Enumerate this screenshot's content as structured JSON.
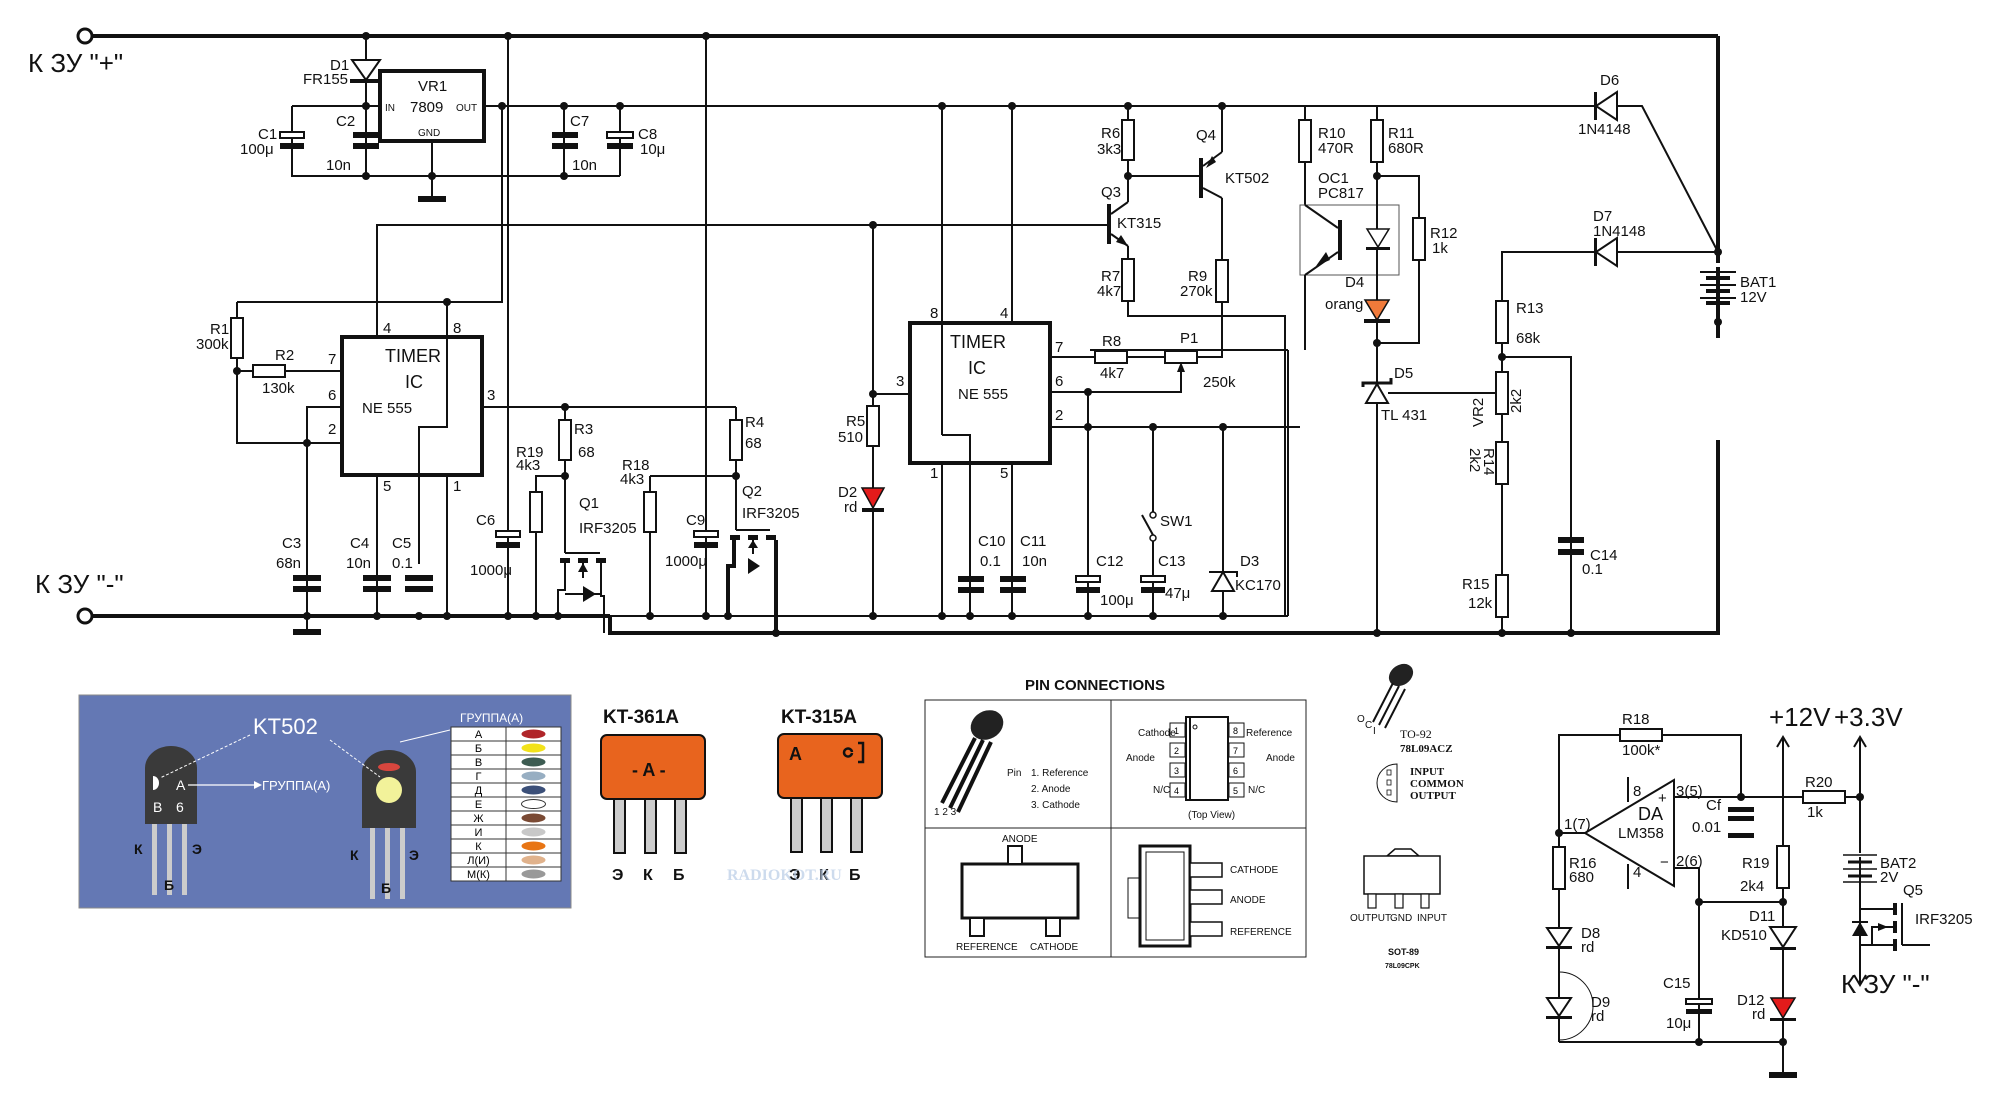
{
  "main": {
    "terminals": {
      "plus": "К ЗУ \"+\"",
      "minus": "К ЗУ \"-\"",
      "minus2": "К ЗУ \"-\""
    },
    "d1": {
      "ref": "D1",
      "val": "FR155"
    },
    "vr1": {
      "ref": "VR1",
      "part": "7809",
      "in": "IN",
      "out": "OUT",
      "gnd": "GND"
    },
    "c1": {
      "ref": "C1",
      "val": "100μ"
    },
    "c2": {
      "ref": "C2",
      "val": "10n"
    },
    "c7": {
      "ref": "C7",
      "val": "10n"
    },
    "c8": {
      "ref": "C8",
      "val": "10μ"
    },
    "timer1": {
      "l1": "TIMER",
      "l2": "IC",
      "part": "NE 555",
      "p4": "4",
      "p8": "8",
      "p7": "7",
      "p6": "6",
      "p2": "2",
      "p3": "3",
      "p5": "5",
      "p1": "1"
    },
    "timer2": {
      "l1": "TIMER",
      "l2": "IC",
      "part": "NE 555",
      "p4": "4",
      "p8": "8",
      "p7": "7",
      "p6": "6",
      "p2": "2",
      "p3": "3",
      "p5": "5",
      "p1": "1"
    },
    "r1": {
      "ref": "R1",
      "val": "300k"
    },
    "r2": {
      "ref": "R2",
      "val": "130k"
    },
    "r3": {
      "ref": "R3",
      "val": "68"
    },
    "r4": {
      "ref": "R4",
      "val": "68"
    },
    "r5": {
      "ref": "R5",
      "val": "510"
    },
    "r6": {
      "ref": "R6",
      "val": "3k3"
    },
    "r7": {
      "ref": "R7",
      "val": "4k7"
    },
    "r8": {
      "ref": "R8",
      "val": "4k7"
    },
    "r9": {
      "ref": "R9",
      "val": "270k"
    },
    "r10": {
      "ref": "R10",
      "val": "470R"
    },
    "r11": {
      "ref": "R11",
      "val": "680R"
    },
    "r12": {
      "ref": "R12",
      "val": "1k"
    },
    "r13": {
      "ref": "R13",
      "val": "68k"
    },
    "r14": {
      "ref": "R14",
      "val": "2k2"
    },
    "r15": {
      "ref": "R15",
      "val": "12k"
    },
    "r18": {
      "ref": "R18",
      "val": "4k3"
    },
    "r19": {
      "ref": "R19",
      "val": "4k3"
    },
    "p1": {
      "ref": "P1",
      "val": "250k"
    },
    "vr2": {
      "ref": "VR2",
      "val": "2k2"
    },
    "c3": {
      "ref": "C3",
      "val": "68n"
    },
    "c4": {
      "ref": "C4",
      "val": "10n"
    },
    "c5": {
      "ref": "C5",
      "val": "0.1"
    },
    "c6": {
      "ref": "C6",
      "val": "1000μ"
    },
    "c9": {
      "ref": "C9",
      "val": "1000μ"
    },
    "c10": {
      "ref": "C10",
      "val": "0.1"
    },
    "c11": {
      "ref": "C11",
      "val": "10n"
    },
    "c12": {
      "ref": "C12",
      "val": "100μ"
    },
    "c13": {
      "ref": "C13",
      "val": "47μ"
    },
    "c14": {
      "ref": "C14",
      "val": "0.1"
    },
    "q1": {
      "ref": "Q1",
      "val": "IRF3205"
    },
    "q2": {
      "ref": "Q2",
      "val": "IRF3205"
    },
    "q3": {
      "ref": "Q3",
      "val": "KT315"
    },
    "q4": {
      "ref": "Q4",
      "val": "KT502"
    },
    "oc1": {
      "ref": "OC1",
      "val": "PC817"
    },
    "d2": {
      "ref": "D2",
      "val": "rd"
    },
    "d3": {
      "ref": "D3",
      "val": "KC170"
    },
    "d4": {
      "ref": "D4",
      "val": "orang"
    },
    "d5": {
      "ref": "D5",
      "val": "TL 431"
    },
    "d6": {
      "ref": "D6",
      "val": "1N4148"
    },
    "d7": {
      "ref": "D7",
      "val": "1N4148"
    },
    "sw1": {
      "ref": "SW1"
    },
    "bat1": {
      "ref": "BAT1",
      "val": "12V"
    }
  },
  "kt502_panel": {
    "title": "KT502",
    "marking_a": "A",
    "marking_b": "B",
    "marking_6": "6",
    "group_label": "ГРУППА(А)",
    "group_label2": "ГРУППА(А)",
    "pins": {
      "k": "К",
      "b": "Б",
      "e": "Э"
    },
    "groups": [
      {
        "letter": "А",
        "color": "#b0262a"
      },
      {
        "letter": "Б",
        "color": "#f2e21a"
      },
      {
        "letter": "В",
        "color": "#3d5c52"
      },
      {
        "letter": "Г",
        "color": "#97aec2"
      },
      {
        "letter": "Д",
        "color": "#3b4f78"
      },
      {
        "letter": "Е",
        "color": "#ffffff"
      },
      {
        "letter": "Ж",
        "color": "#7a4a34"
      },
      {
        "letter": "И",
        "color": "#c8c8c8"
      },
      {
        "letter": "К",
        "color": "#e87514"
      },
      {
        "letter": "Л(И)",
        "color": "#e0b28c"
      },
      {
        "letter": "М(К)",
        "color": "#999999"
      }
    ],
    "bg_color": "#6478b4"
  },
  "kt361": {
    "title": "KT-361A",
    "mark": "- A -",
    "pins": [
      "Э",
      "К",
      "Б"
    ],
    "color": "#e8641e"
  },
  "kt315": {
    "title": "KT-315A",
    "mark": "A",
    "pins": [
      "Э",
      "К",
      "Б"
    ],
    "color": "#e8641e"
  },
  "watermark": "RADIOKOT.RU",
  "pin_connections": {
    "title": "PIN CONNECTIONS",
    "to92_pin_label": "Pin",
    "to92_pins": [
      "1.  Reference",
      "2.  Anode",
      "3.  Cathode"
    ],
    "to92_numbers": "1 2 3",
    "so8_left": [
      "Cathode",
      "Anode",
      "N/C"
    ],
    "so8_right": [
      "Reference",
      "Anode",
      "N/C"
    ],
    "so8_pins_left": [
      "1",
      "2",
      "3",
      "4"
    ],
    "so8_pins_right": [
      "8",
      "7",
      "6",
      "5"
    ],
    "so8_caption": "(Top View)",
    "sot23": {
      "top": "ANODE",
      "left": "REFERENCE",
      "right": "CATHODE"
    },
    "sot89": [
      "CATHODE",
      "ANODE",
      "REFERENCE"
    ]
  },
  "regulator_pkg": {
    "to92": "TO-92",
    "to92_part": "78L09ACZ",
    "to92_pins": [
      "INPUT",
      "COMMON",
      "OUTPUT"
    ],
    "to92_leg_labels": [
      "O",
      "C",
      "I"
    ],
    "sot89_pins": [
      "OUTPUT",
      "GND",
      "INPUT"
    ],
    "sot89": "SOT-89",
    "sot89_part": "78L09CPK"
  },
  "aux": {
    "r18": {
      "ref": "R18",
      "val": "100k*"
    },
    "da": {
      "ref": "DA",
      "part": "LM358",
      "p8": "8",
      "p4": "4",
      "p_out": "1(7)",
      "p_plus": "3(5)",
      "p_minus": "2(6)"
    },
    "cf": {
      "ref": "Cf",
      "val": "0.01"
    },
    "r16": {
      "ref": "R16",
      "val": "680"
    },
    "r19": {
      "ref": "R19",
      "val": "2k4"
    },
    "r20": {
      "ref": "R20",
      "val": "1k"
    },
    "d8": {
      "ref": "D8",
      "val": "rd"
    },
    "d9": {
      "ref": "D9",
      "val": "rd"
    },
    "d11": {
      "ref": "D11",
      "val": "KD510"
    },
    "d12": {
      "ref": "D12",
      "val": "rd"
    },
    "c15": {
      "ref": "C15",
      "val": "10μ"
    },
    "bat2": {
      "ref": "BAT2",
      "val": "2V"
    },
    "q5": {
      "ref": "Q5",
      "val": "IRF3205"
    },
    "v12": "+12V",
    "v33": "+3.3V",
    "minus": "К ЗУ \"-\""
  },
  "colors": {
    "led_red": "#e31b1b",
    "led_orange": "#f07a3a"
  }
}
